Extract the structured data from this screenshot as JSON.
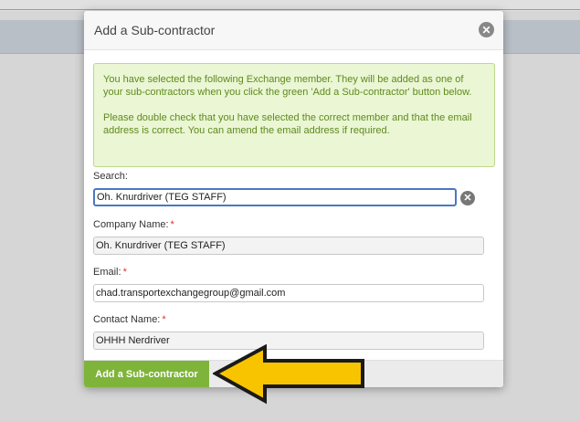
{
  "modal": {
    "title": "Add a Sub-contractor",
    "close_icon": "close-icon"
  },
  "notice": {
    "paragraph1": "You have selected the following Exchange member. They will be added as one of your sub-contractors when you click the green 'Add a Sub-contractor' button below.",
    "paragraph2": "Please double check that you have selected the correct member and that the email address is correct. You can amend the email address if required."
  },
  "form": {
    "search": {
      "label": "Search:",
      "value": "Oh. Knurdriver (TEG STAFF)",
      "clear_icon": "clear-icon"
    },
    "company": {
      "label": "Company Name:",
      "required": "*",
      "value": "Oh. Knurdriver (TEG STAFF)"
    },
    "email": {
      "label": "Email:",
      "required": "*",
      "value": "chad.transportexchangegroup@gmail.com"
    },
    "contact": {
      "label": "Contact Name:",
      "required": "*",
      "value": "OHHH Nerdriver"
    }
  },
  "footer": {
    "add_button_label": "Add a Sub-contractor"
  },
  "colors": {
    "accent_green": "#7fb43a",
    "notice_bg": "#eaf6d4",
    "notice_text": "#5f8a1e",
    "required": "#e0322b",
    "search_border": "#4a78c3",
    "arrow_fill": "#f8c400"
  }
}
